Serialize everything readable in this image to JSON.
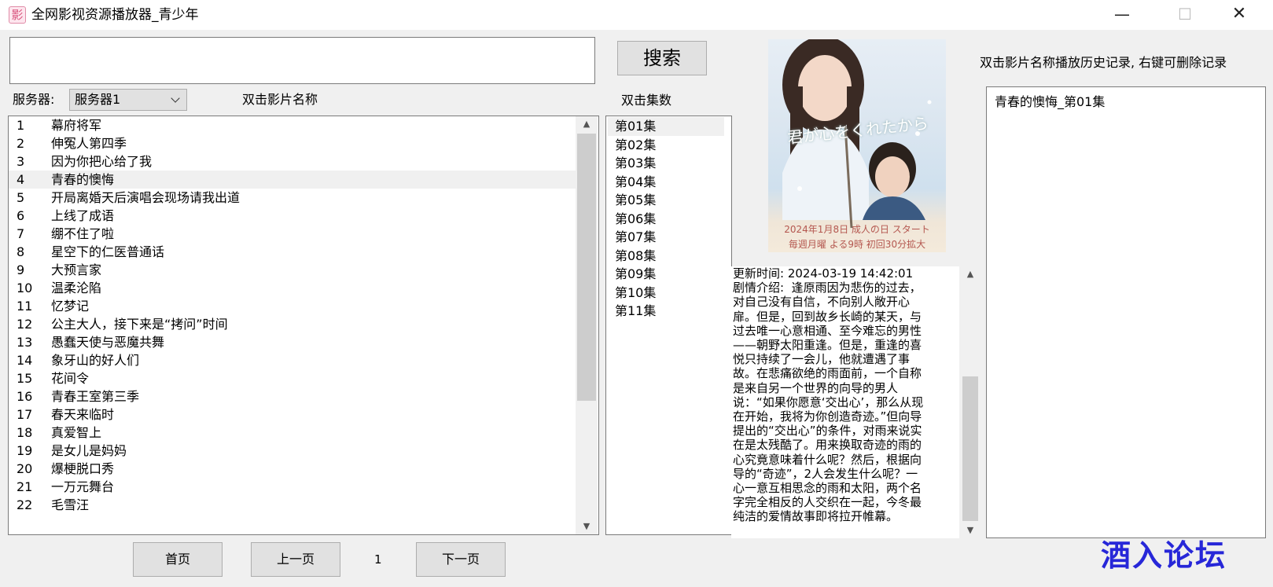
{
  "window": {
    "title": "全网影视资源播放器_青少年",
    "app_icon_glyph": "影",
    "minimize_glyph": "—",
    "maximize_glyph": "☐",
    "close_glyph": "✕"
  },
  "search": {
    "value": "",
    "button_label": "搜索"
  },
  "server": {
    "label": "服务器:",
    "selected": "服务器1"
  },
  "hints": {
    "film_title": "双击影片名称",
    "episode": "双击集数",
    "history": "双击影片名称播放历史记录, 右键可删除记录"
  },
  "film_list": [
    {
      "num": "1",
      "name": "幕府将军"
    },
    {
      "num": "2",
      "name": "伸冤人第四季"
    },
    {
      "num": "3",
      "name": "因为你把心给了我"
    },
    {
      "num": "4",
      "name": "青春的懊悔"
    },
    {
      "num": "5",
      "name": "开局离婚天后演唱会现场请我出道"
    },
    {
      "num": "6",
      "name": "上线了成语"
    },
    {
      "num": "7",
      "name": "绷不住了啦"
    },
    {
      "num": "8",
      "name": "星空下的仁医普通话"
    },
    {
      "num": "9",
      "name": "大预言家"
    },
    {
      "num": "10",
      "name": "温柔沦陷"
    },
    {
      "num": "11",
      "name": "忆梦记"
    },
    {
      "num": "12",
      "name": "公主大人，接下来是“拷问”时间"
    },
    {
      "num": "13",
      "name": "愚蠢天使与恶魔共舞"
    },
    {
      "num": "14",
      "name": "象牙山的好人们"
    },
    {
      "num": "15",
      "name": "花间令"
    },
    {
      "num": "16",
      "name": "青春王室第三季"
    },
    {
      "num": "17",
      "name": "春天来临时"
    },
    {
      "num": "18",
      "name": "真爱智上"
    },
    {
      "num": "19",
      "name": "是女儿是妈妈"
    },
    {
      "num": "20",
      "name": "爆梗脱口秀"
    },
    {
      "num": "21",
      "name": "一万元舞台"
    },
    {
      "num": "22",
      "name": "毛雪汪"
    }
  ],
  "selected_film_index": 3,
  "episodes": [
    "第01集",
    "第02集",
    "第03集",
    "第04集",
    "第05集",
    "第06集",
    "第07集",
    "第08集",
    "第09集",
    "第10集",
    "第11集"
  ],
  "selected_episode_index": 0,
  "poster": {
    "title_art": "君が心をくれたから",
    "line1": "2024年1月8日 成人の日 スタート",
    "line2": "毎週月曜 よる9時 初回30分拡大"
  },
  "description": "更新时间: 2024-03-19 14:42:01\n剧情介绍:  逢原雨因为悲伤的过去，对自己没有自信，不向别人敞开心扉。但是，回到故乡长崎的某天，与过去唯一心意相通、至今难忘的男性——朝野太阳重逢。但是，重逢的喜悦只持续了一会儿，他就遭遇了事故。在悲痛欲绝的雨面前，一个自称是来自另一个世界的向导的男人说：“如果你愿意‘交出心’，那么从现在开始，我将为你创造奇迹。”但向导提出的“交出心”的条件，对雨来说实在是太残酷了。用来换取奇迹的雨的心究竟意味着什么呢？然后，根据向导的“奇迹”，2人会发生什么呢？一心一意互相思念的雨和太阳，两个名字完全相反的人交织在一起，今冬最纯洁的爱情故事即将拉开帷幕。",
  "history": [
    "青春的懊悔_第01集"
  ],
  "pagination": {
    "first": "首页",
    "prev": "上一页",
    "page": "1",
    "next": "下一页"
  },
  "watermark": "酒入论坛",
  "scroll_arrows": {
    "up": "▲",
    "down": "▼"
  },
  "colors": {
    "watermark": "#2727d8",
    "selection": "#f0f0f0",
    "window_bg": "#f0f0f0"
  }
}
